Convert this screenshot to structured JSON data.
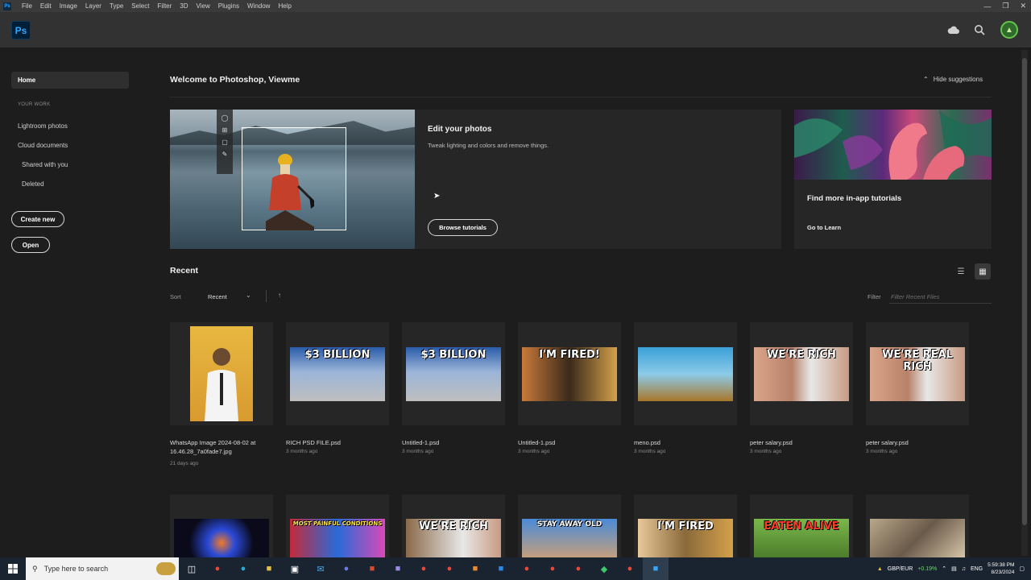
{
  "menubar": {
    "items": [
      "File",
      "Edit",
      "Image",
      "Layer",
      "Type",
      "Select",
      "Filter",
      "3D",
      "View",
      "Plugins",
      "Window",
      "Help"
    ]
  },
  "app": {
    "logo": "Ps"
  },
  "sidebar": {
    "home": "Home",
    "section": "YOUR WORK",
    "items": [
      "Lightroom photos",
      "Cloud documents",
      "Shared with you",
      "Deleted"
    ],
    "create_new": "Create new",
    "open": "Open"
  },
  "main": {
    "welcome": "Welcome to Photoshop, Viewme",
    "hide_suggestions": "Hide suggestions",
    "hero": {
      "title": "Edit your photos",
      "subtitle": "Tweak lighting and colors and remove things.",
      "button": "Browse tutorials"
    },
    "learn": {
      "title": "Find more in-app tutorials",
      "link": "Go to Learn"
    },
    "recent": {
      "title": "Recent",
      "sort_label": "Sort",
      "sort_value": "Recent",
      "filter_label": "Filter",
      "filter_placeholder": "Filter Recent Files"
    },
    "files": [
      {
        "name": "WhatsApp Image 2024-08-02 at 16.46.28_7a0fade7.jpg",
        "meta": "21 days ago",
        "caption": ""
      },
      {
        "name": "RICH PSD FILE.psd",
        "meta": "3 months ago",
        "caption": "$3 BILLION"
      },
      {
        "name": "Untitled-1.psd",
        "meta": "3 months ago",
        "caption": "$3 BILLION"
      },
      {
        "name": "Untitled-1.psd",
        "meta": "3 months ago",
        "caption": "I'M FIRED!"
      },
      {
        "name": "meno.psd",
        "meta": "3 months ago",
        "caption": ""
      },
      {
        "name": "peter salary.psd",
        "meta": "3 months ago",
        "caption": "WE'RE RICH"
      },
      {
        "name": "peter salary.psd",
        "meta": "3 months ago",
        "caption": "WE'RE REAL RICH"
      }
    ],
    "files_row2": [
      {
        "caption": ""
      },
      {
        "caption": "MOST PAINFUL CONDITIONS"
      },
      {
        "caption": "WE'RE RICH"
      },
      {
        "caption": "STAY AWAY OLD"
      },
      {
        "caption": "I'M FIRED"
      },
      {
        "caption": "EATEN ALIVE"
      },
      {
        "caption": ""
      }
    ]
  },
  "taskbar": {
    "search_placeholder": "Type here to search",
    "currency": "GBP/EUR",
    "currency_change": "+0.19%",
    "lang": "ENG",
    "time": "5:59:38 PM",
    "date": "8/23/2024"
  },
  "colors": {
    "bg": "#1d1d1d",
    "panel": "#262626",
    "accent": "#31a8ff"
  }
}
